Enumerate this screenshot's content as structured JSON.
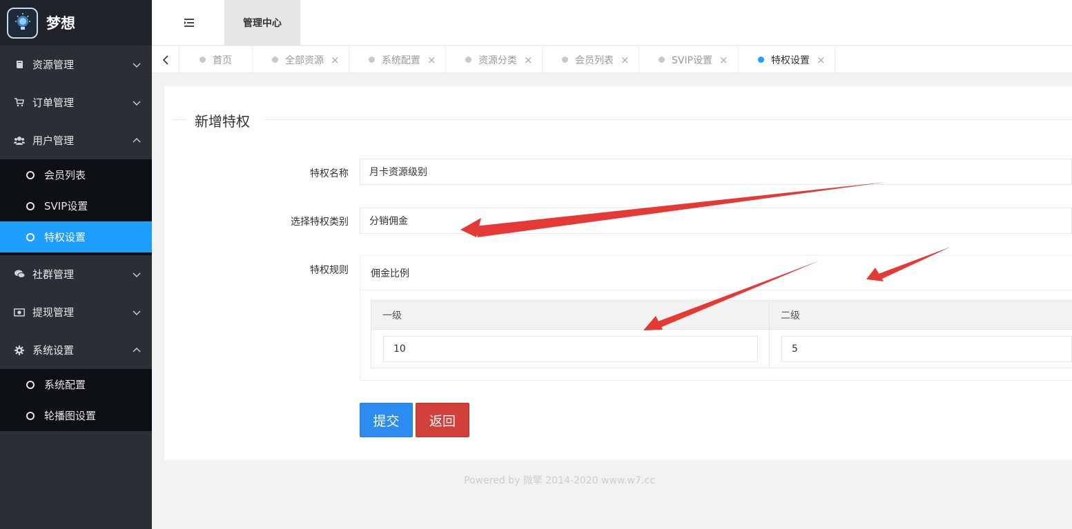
{
  "app": {
    "brand": "梦想"
  },
  "sidebar": {
    "items": [
      {
        "label": "资源管理",
        "icon": "book-icon",
        "expanded": false
      },
      {
        "label": "订单管理",
        "icon": "cart-icon",
        "expanded": false
      },
      {
        "label": "用户管理",
        "icon": "users-icon",
        "expanded": true,
        "children": [
          {
            "label": "会员列表",
            "active": false
          },
          {
            "label": "SVIP设置",
            "active": false
          },
          {
            "label": "特权设置",
            "active": true
          }
        ]
      },
      {
        "label": "社群管理",
        "icon": "chat-icon",
        "expanded": false
      },
      {
        "label": "提现管理",
        "icon": "money-icon",
        "expanded": false
      },
      {
        "label": "系统设置",
        "icon": "gear-icon",
        "expanded": true,
        "children": [
          {
            "label": "系统配置",
            "active": false
          },
          {
            "label": "轮播图设置",
            "active": false
          }
        ]
      }
    ]
  },
  "header": {
    "top_tab": "管理中心"
  },
  "tabs": [
    {
      "label": "首页",
      "closable": false,
      "active": false
    },
    {
      "label": "全部资源",
      "closable": true,
      "active": false
    },
    {
      "label": "系统配置",
      "closable": true,
      "active": false
    },
    {
      "label": "资源分类",
      "closable": true,
      "active": false
    },
    {
      "label": "会员列表",
      "closable": true,
      "active": false
    },
    {
      "label": "SVIP设置",
      "closable": true,
      "active": false
    },
    {
      "label": "特权设置",
      "closable": true,
      "active": true
    }
  ],
  "form": {
    "legend": "新增特权",
    "name_label": "特权名称",
    "name_value": "月卡资源级别",
    "type_label": "选择特权类别",
    "type_value": "分销佣金",
    "rule_label": "特权规则",
    "rule_title": "佣金比例",
    "rule_columns": [
      "一级",
      "二级"
    ],
    "rule_values": [
      "10",
      "5"
    ],
    "submit_label": "提交",
    "back_label": "返回"
  },
  "footer": {
    "text": "Powered by 微擎 2014-2020 www.w7.cc"
  },
  "colors": {
    "accent": "#1e9fff",
    "submit": "#2d8cf0",
    "back": "#d2403b",
    "annotation": "#e53935"
  }
}
